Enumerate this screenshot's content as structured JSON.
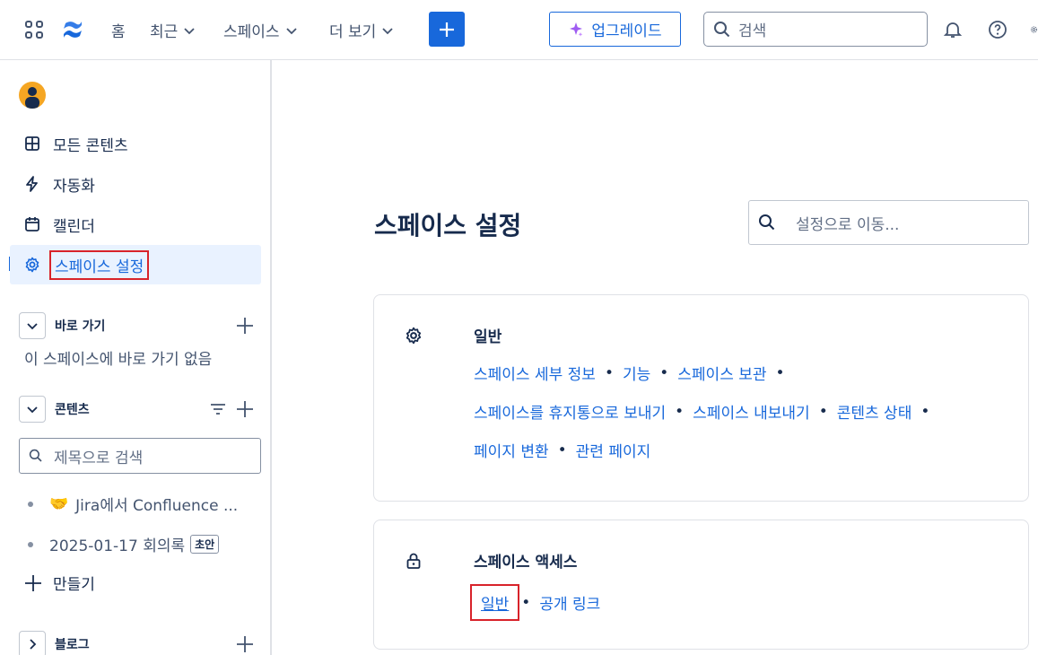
{
  "topbar": {
    "nav": [
      {
        "label": "홈",
        "has_menu": false
      },
      {
        "label": "최근",
        "has_menu": true
      },
      {
        "label": "스페이스",
        "has_menu": true
      },
      {
        "label": "더 보기",
        "has_menu": true
      }
    ],
    "upgrade_label": "업그레이드",
    "search_placeholder": "검색"
  },
  "sidebar": {
    "items": [
      {
        "label": "모든 콘텐츠",
        "icon": "grid-icon"
      },
      {
        "label": "자동화",
        "icon": "lightning-icon"
      },
      {
        "label": "캘린더",
        "icon": "calendar-icon"
      },
      {
        "label": "스페이스 설정",
        "icon": "gear-icon",
        "active": true
      }
    ],
    "shortcuts": {
      "title": "바로 가기",
      "empty": "이 스페이스에 바로 가기 없음"
    },
    "content": {
      "title": "콘텐츠",
      "search_placeholder": "제목으로 검색",
      "tree": [
        {
          "emoji": "🤝",
          "label": "Jira에서 Confluence ..."
        },
        {
          "label": "2025-01-17 회의록",
          "badge": "초안"
        }
      ],
      "create_label": "만들기"
    },
    "blog": {
      "title": "블로그"
    }
  },
  "main": {
    "title": "스페이스 설정",
    "search_placeholder": "설정으로 이동...",
    "cards": [
      {
        "title": "일반",
        "icon": "gear-icon",
        "rows": [
          [
            "스페이스 세부 정보",
            "기능",
            "스페이스 보관"
          ],
          [
            "스페이스를 휴지통으로 보내기",
            "스페이스 내보내기",
            "콘텐츠 상태"
          ],
          [
            "페이지 변환",
            "관련 페이지"
          ]
        ]
      },
      {
        "title": "스페이스 액세스",
        "icon": "lock-icon",
        "rows": [
          [
            "일반",
            "공개 링크"
          ]
        ]
      }
    ]
  },
  "colors": {
    "accent": "#1868db",
    "highlight": "#d8232a",
    "text": "#172b4d",
    "active_bg": "#e9f2ff"
  }
}
